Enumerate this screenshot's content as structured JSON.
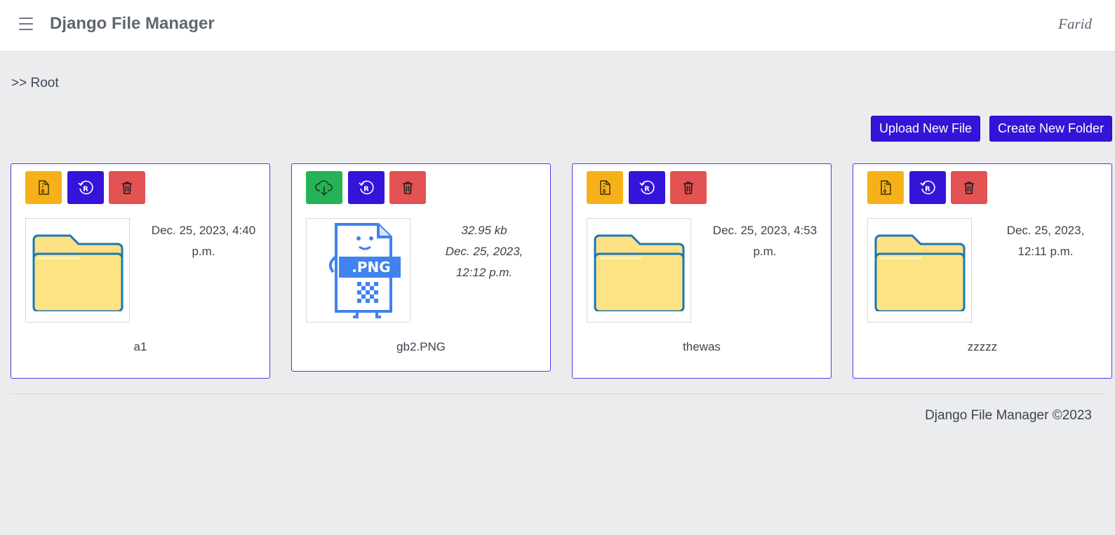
{
  "navbar": {
    "menu_icon": "hamburger-menu-icon",
    "brand": "Django File Manager",
    "user": "Farid"
  },
  "breadcrumb": {
    "text": ">> Root"
  },
  "toolbar": {
    "upload_label": "Upload New File",
    "create_folder_label": "Create New Folder",
    "accent_color": "#3414d8"
  },
  "items": [
    {
      "type": "folder",
      "name": "a1",
      "date": "Dec. 25, 2023, 4:40",
      "time": "p.m.",
      "actions": [
        "zip-file-icon",
        "rename-icon",
        "trash-icon"
      ]
    },
    {
      "type": "file",
      "name": "gb2.PNG",
      "size": "32.95 kb",
      "date": "Dec. 25, 2023,",
      "time": "12:12 p.m.",
      "thumb_label": ".PNG",
      "actions": [
        "cloud-download-icon",
        "rename-icon",
        "trash-icon"
      ]
    },
    {
      "type": "folder",
      "name": "thewas",
      "date": "Dec. 25, 2023, 4:53",
      "time": "p.m.",
      "actions": [
        "zip-file-icon",
        "rename-icon",
        "trash-icon"
      ]
    },
    {
      "type": "folder",
      "name": "zzzzz",
      "date": "Dec. 25, 2023,",
      "time": "12:11 p.m.",
      "actions": [
        "zip-file-icon",
        "rename-icon",
        "trash-icon"
      ]
    }
  ],
  "colors": {
    "zip": "#f7b118",
    "download": "#26b356",
    "rename": "#3414d8",
    "delete": "#e35353"
  },
  "footer": {
    "text": "Django File Manager ©2023"
  }
}
